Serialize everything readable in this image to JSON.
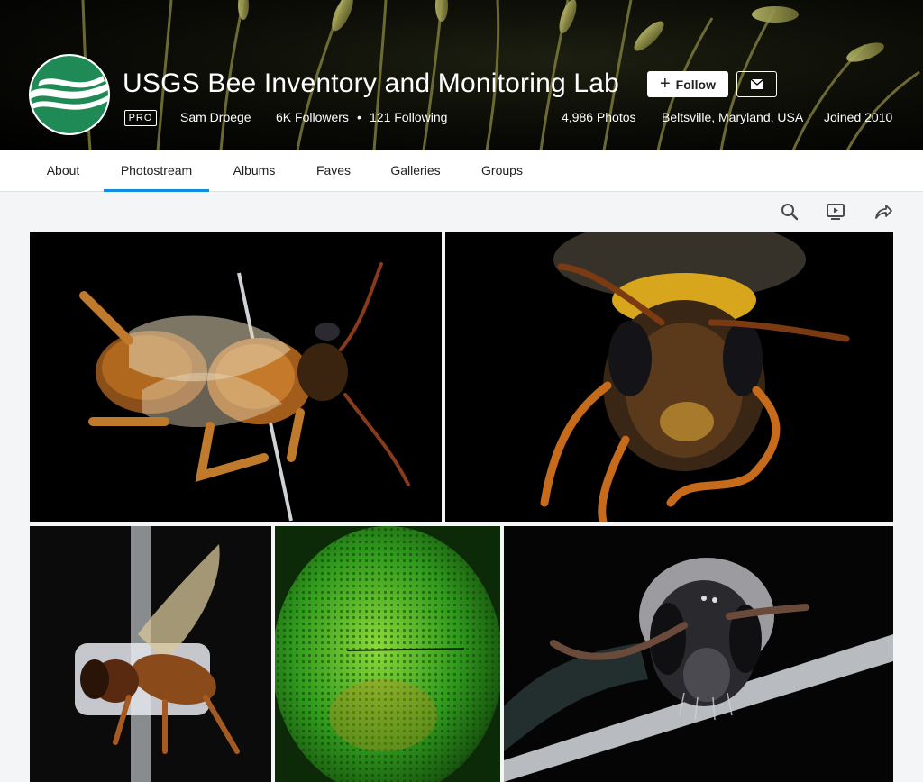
{
  "profile": {
    "title": "USGS Bee Inventory and Monitoring Lab",
    "pro_label": "PRO",
    "real_name": "Sam Droege",
    "followers": "6K Followers",
    "separator": "•",
    "following": "121 Following",
    "photos": "4,986 Photos",
    "location": "Beltsville, Maryland, USA",
    "joined": "Joined 2010",
    "follow_label": "Follow",
    "avatar_colors": {
      "green": "#1f8a56",
      "white": "#ffffff"
    }
  },
  "nav": {
    "tabs": [
      {
        "label": "About"
      },
      {
        "label": "Photostream",
        "active": true
      },
      {
        "label": "Albums"
      },
      {
        "label": "Faves"
      },
      {
        "label": "Galleries"
      },
      {
        "label": "Groups"
      }
    ]
  },
  "toolbar": {
    "icons": [
      "search-icon",
      "slideshow-icon",
      "share-icon"
    ]
  },
  "photos": [
    {
      "subject": "bee-side-view",
      "bg": "#000000",
      "accent": "#b36a1e"
    },
    {
      "subject": "bee-face-front",
      "bg": "#000000",
      "accent": "#c26a1c"
    },
    {
      "subject": "bee-on-pin",
      "bg": "#0b0b0b",
      "accent": "#8a4a1a"
    },
    {
      "subject": "green-thorax-texture",
      "bg": "#0d2a08",
      "accent": "#3fb51e"
    },
    {
      "subject": "gray-bee-face",
      "bg": "#050505",
      "accent": "#5a5a5e"
    }
  ],
  "colors": {
    "accent": "#128fdc",
    "text": "#212124",
    "page_bg": "#f3f5f6"
  }
}
